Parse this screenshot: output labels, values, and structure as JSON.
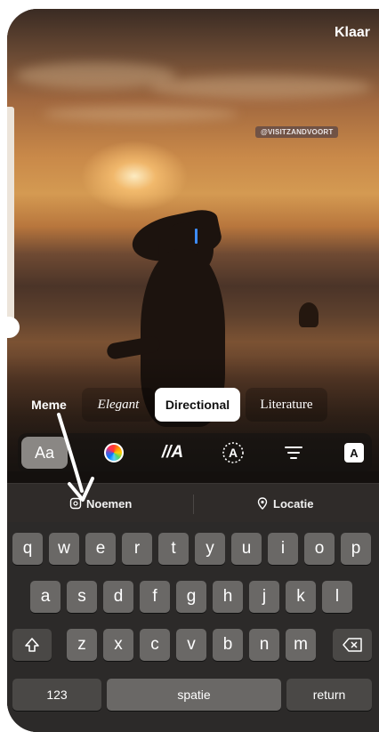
{
  "header": {
    "done_label": "Klaar"
  },
  "overlay": {
    "mention_tag": "@VISITZANDVOORT"
  },
  "text_styles": [
    "Meme",
    "Elegant",
    "Directional",
    "Literature"
  ],
  "selected_style": "Directional",
  "tools": {
    "font_label": "Aa",
    "effect_label": "//A",
    "animate_label": "A",
    "background_label": "A",
    "icons": [
      "color-picker-icon",
      "text-effect-icon",
      "animate-icon",
      "align-icon",
      "text-background-icon"
    ]
  },
  "suggestions": {
    "mention": "Noemen",
    "location": "Locatie"
  },
  "keyboard": {
    "row1": [
      "q",
      "w",
      "e",
      "r",
      "t",
      "y",
      "u",
      "i",
      "o",
      "p"
    ],
    "row2": [
      "a",
      "s",
      "d",
      "f",
      "g",
      "h",
      "j",
      "k",
      "l"
    ],
    "row3": [
      "z",
      "x",
      "c",
      "v",
      "b",
      "n",
      "m"
    ],
    "numbers": "123",
    "space": "spatie",
    "return": "return"
  }
}
